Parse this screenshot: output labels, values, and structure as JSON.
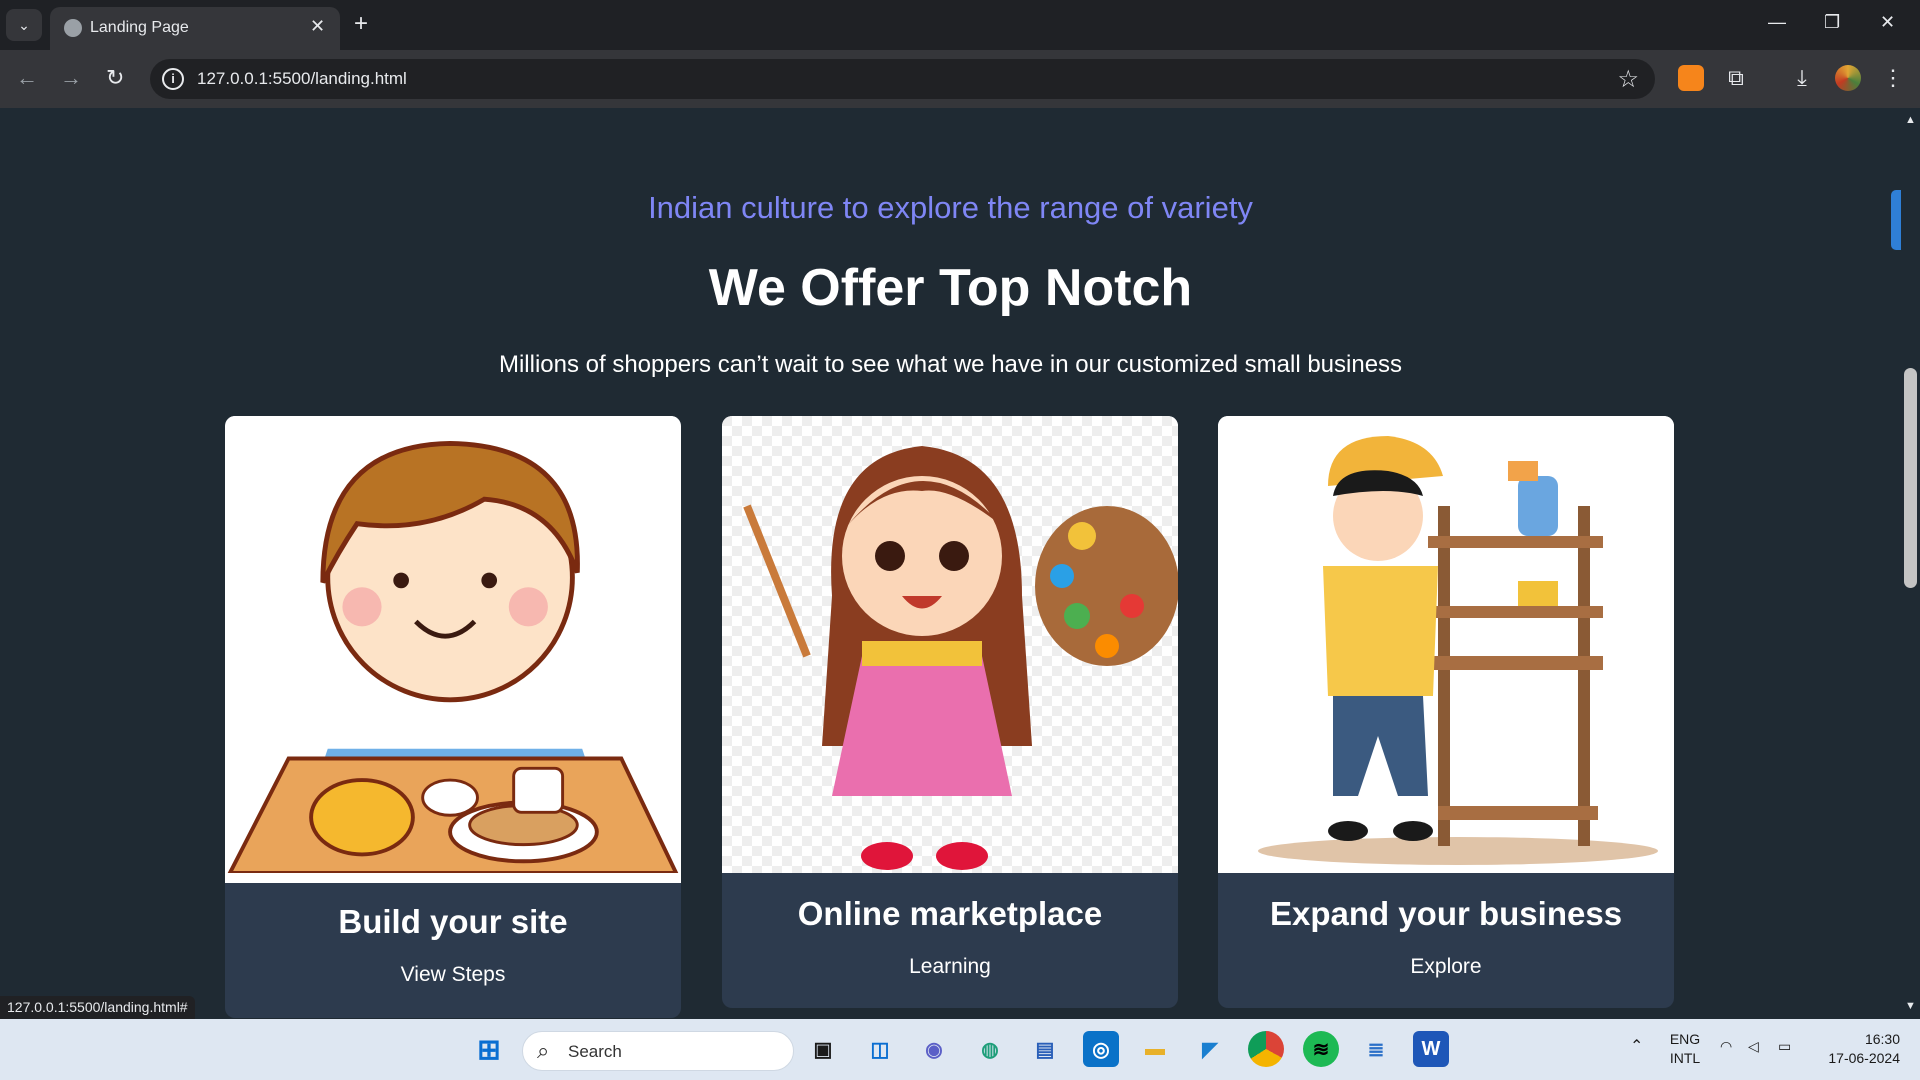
{
  "browser": {
    "tab_title": "Landing Page",
    "url": "127.0.0.1:5500/landing.html",
    "status_url": "127.0.0.1:5500/landing.html#"
  },
  "page": {
    "subtitle": "Indian culture to explore the range of variety",
    "heading": "We Offer Top Notch",
    "tagline": "Millions of shoppers can’t wait to see what we have in our customized small business",
    "cards": [
      {
        "title": "Build your site",
        "link": "View Steps",
        "image": "boy-eating-illustration"
      },
      {
        "title": "Online marketplace",
        "link": "Learning",
        "image": "girl-painting-illustration"
      },
      {
        "title": "Expand your business",
        "link": "Explore",
        "image": "boy-with-shelf-illustration"
      }
    ]
  },
  "taskbar": {
    "search_placeholder": "Search",
    "lang_primary": "ENG",
    "lang_secondary": "INTL",
    "time": "16:30",
    "date": "17-06-2024"
  }
}
